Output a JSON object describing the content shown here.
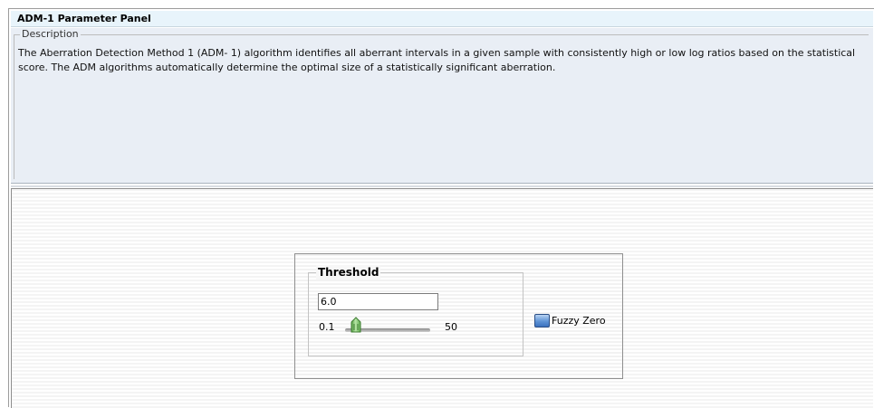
{
  "panel": {
    "title": "ADM-1 Parameter Panel"
  },
  "description": {
    "legend": "Description",
    "text": "The Aberration Detection Method 1 (ADM- 1) algorithm identifies all aberrant intervals in a given sample with consistently high or low log ratios based on the statistical score. The ADM algorithms automatically determine the optimal size of a statistically significant aberration."
  },
  "threshold": {
    "legend": "Threshold",
    "value": "6.0",
    "slider_min": "0.1",
    "slider_max": "50"
  },
  "fuzzy_zero": {
    "label": "Fuzzy Zero",
    "checked": false
  },
  "icons": {
    "slider_thumb": "slider-thumb-icon",
    "checkbox": "checkbox-icon"
  },
  "colors": {
    "title_bar_bg": "#e8f4fb",
    "description_bg": "#e9eef5",
    "thumb_green": "#7cc46a",
    "checkbox_blue": "#4a82cc"
  }
}
